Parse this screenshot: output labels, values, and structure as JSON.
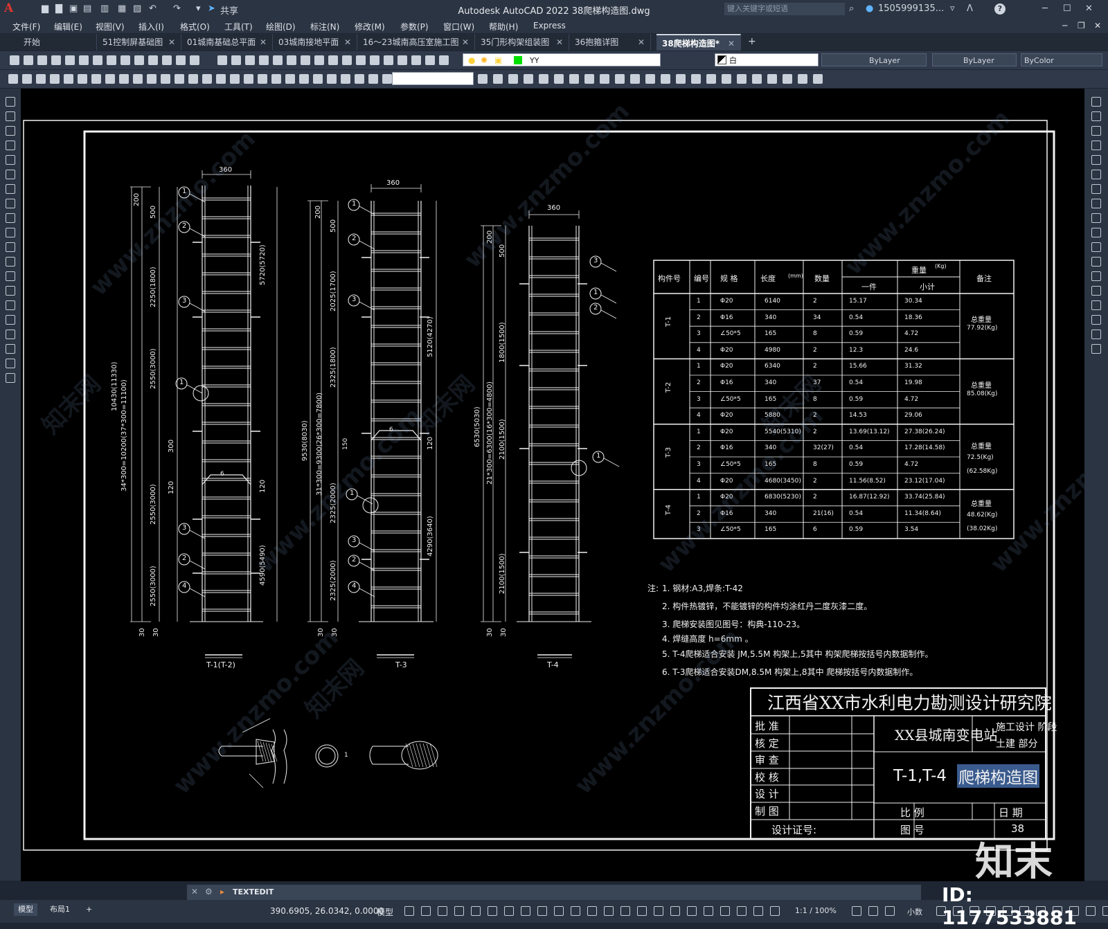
{
  "app": {
    "logo_letter": "A",
    "title": "Autodesk AutoCAD 2022    38爬梯构造图.dwg",
    "share_label": "共享",
    "search_placeholder": "键入关键字或短语",
    "user": "1505999135...",
    "help": "?"
  },
  "menus": [
    "文件(F)",
    "编辑(E)",
    "视图(V)",
    "插入(I)",
    "格式(O)",
    "工具(T)",
    "绘图(D)",
    "标注(N)",
    "修改(M)",
    "参数(P)",
    "窗口(W)",
    "帮助(H)",
    "Express"
  ],
  "tabs": [
    {
      "label": "开始",
      "closable": false,
      "active": false
    },
    {
      "label": "51控制屏基础图",
      "closable": true,
      "active": false
    },
    {
      "label": "01城南基础总平面",
      "closable": true,
      "active": false
    },
    {
      "label": "03城南接地平面",
      "closable": true,
      "active": false
    },
    {
      "label": "16～23城南高压室施工图",
      "closable": true,
      "active": false
    },
    {
      "label": "35门形构架组装图",
      "closable": true,
      "active": false
    },
    {
      "label": "36抱箍详图",
      "closable": true,
      "active": false
    },
    {
      "label": "38爬梯构造图*",
      "closable": true,
      "active": true
    }
  ],
  "properties": {
    "layer": "YY",
    "color": "白",
    "linetype": "ByLayer",
    "lineweight": "ByLayer",
    "plotstyle": "ByColor"
  },
  "drawing": {
    "ladder_labels": [
      "T-1(T-2)",
      "T-3",
      "T-4"
    ],
    "width_dim": "360",
    "dims": {
      "t1_total": "10430(11330)",
      "t1_spacing": "34*300=10200(37*300=11100)",
      "t1_a": "2250(1800)",
      "t1_b": "2550(3000)",
      "t1_c": "2550(3000)",
      "t1_d": "2550(3000)",
      "t1_right_top": "5720(5720)",
      "t1_right_bot": "4590(5490)",
      "t3_total": "9530(8030)",
      "t3_spacing": "31*300=9300(26*300=7800)",
      "t3_a": "2025(1700)",
      "t3_b": "2325(1800)",
      "t3_c": "2325(2000)",
      "t3_d": "2325(2000)",
      "t3_right_top": "5120(4270)",
      "t3_right_bot": "4290(3640)",
      "t4_total": "6530(5030)",
      "t4_spacing": "21*300=6300(16*300=4800)",
      "t4_a": "1800(1500)",
      "t4_b": "2100(1500)",
      "t4_c": "2100(1500)",
      "d200": "200",
      "d500": "500",
      "d300": "300",
      "d120": "120",
      "d30": "30",
      "d150": "150",
      "d6": "6"
    },
    "callouts": [
      "1",
      "2",
      "3",
      "4"
    ]
  },
  "table": {
    "headers": {
      "member": "构件号",
      "no": "编号",
      "spec": "规 格",
      "length": "长度",
      "length_unit": "(mm)",
      "qty": "数量",
      "weight": "重量",
      "weight_unit": "(Kg)",
      "each": "一件",
      "subtotal": "小计",
      "remark": "备注"
    },
    "groups": [
      {
        "member": "T-1",
        "remark_title": "总重量",
        "remark_values": [
          "77.92(Kg)"
        ],
        "rows": [
          [
            "1",
            "Φ20",
            "6140",
            "2",
            "15.17",
            "30.34"
          ],
          [
            "2",
            "Φ16",
            "340",
            "34",
            "0.54",
            "18.36"
          ],
          [
            "3",
            "∠50*5",
            "165",
            "8",
            "0.59",
            "4.72"
          ],
          [
            "4",
            "Φ20",
            "4980",
            "2",
            "12.3",
            "24.6"
          ]
        ]
      },
      {
        "member": "T-2",
        "remark_title": "总重量",
        "remark_values": [
          "85.08(Kg)"
        ],
        "rows": [
          [
            "1",
            "Φ20",
            "6340",
            "2",
            "15.66",
            "31.32"
          ],
          [
            "2",
            "Φ16",
            "340",
            "37",
            "0.54",
            "19.98"
          ],
          [
            "3",
            "∠50*5",
            "165",
            "8",
            "0.59",
            "4.72"
          ],
          [
            "4",
            "Φ20",
            "5880",
            "2",
            "14.53",
            "29.06"
          ]
        ]
      },
      {
        "member": "T-3",
        "remark_title": "总重量",
        "remark_values": [
          "72.5(Kg)",
          "(62.58Kg)"
        ],
        "rows": [
          [
            "1",
            "Φ20",
            "5540(5310)",
            "2",
            "13.69(13.12)",
            "27.38(26.24)"
          ],
          [
            "2",
            "Φ16",
            "340",
            "32(27)",
            "0.54",
            "17.28(14.58)"
          ],
          [
            "3",
            "∠50*5",
            "165",
            "8",
            "0.59",
            "4.72"
          ],
          [
            "4",
            "Φ20",
            "4680(3450)",
            "2",
            "11.56(8.52)",
            "23.12(17.04)"
          ]
        ]
      },
      {
        "member": "T-4",
        "remark_title": "总重量",
        "remark_values": [
          "48.62(Kg)",
          "(38.02Kg)"
        ],
        "rows": [
          [
            "1",
            "Φ20",
            "6830(5230)",
            "2",
            "16.87(12.92)",
            "33.74(25.84)"
          ],
          [
            "2",
            "Φ16",
            "340",
            "21(16)",
            "0.54",
            "11.34(8.64)"
          ],
          [
            "3",
            "∠50*5",
            "165",
            "6",
            "0.59",
            "3.54"
          ]
        ]
      }
    ]
  },
  "notes": {
    "prefix": "注:",
    "items": [
      "1. 钢材:A3,焊条:T-42",
      "2. 构件热镀锌，不能镀锌的构件均涂红丹二度灰漆二度。",
      "3. 爬梯安装图见图号：构典-110-23。",
      "4. 焊缝高度  h=6mm 。",
      "5. T-4爬梯适合安装 JM,5.5M   构架上,5其中      构架爬梯按括号内数据制作。",
      "6. T-3爬梯适合安装DM,8.5M    构架上,8其中      爬梯按括号内数据制作。"
    ]
  },
  "titleblock": {
    "institute": "江西省XX市水利电力勘测设计研究院",
    "project": "XX县城南变电站",
    "stage_label": "施工设计   阶段",
    "part_label": "土建       部分",
    "drawing_title_a": "T-1,T-4",
    "drawing_title_b": "爬梯构造图",
    "roles": [
      "批  准",
      "核  定",
      "审  查",
      "校  核",
      "设  计",
      "制  图"
    ],
    "scale_label": "比  例",
    "date_label": "日  期",
    "cert_label": "设计证号:",
    "drawing_no_label": "图  号",
    "drawing_no": "38"
  },
  "detail_callout": "1",
  "command": {
    "text": "TEXTEDIT"
  },
  "status": {
    "layout_tabs": [
      "模型",
      "布局1"
    ],
    "add": "+",
    "coords": "390.6905, 26.0342, 0.0000",
    "model_label": "模型",
    "scale": "1:1 / 100%",
    "units": "小数"
  },
  "watermarks": [
    "www.znzmo.com",
    "知末网"
  ],
  "id_badge": "ID: 1177533881",
  "logo_text": "知末"
}
